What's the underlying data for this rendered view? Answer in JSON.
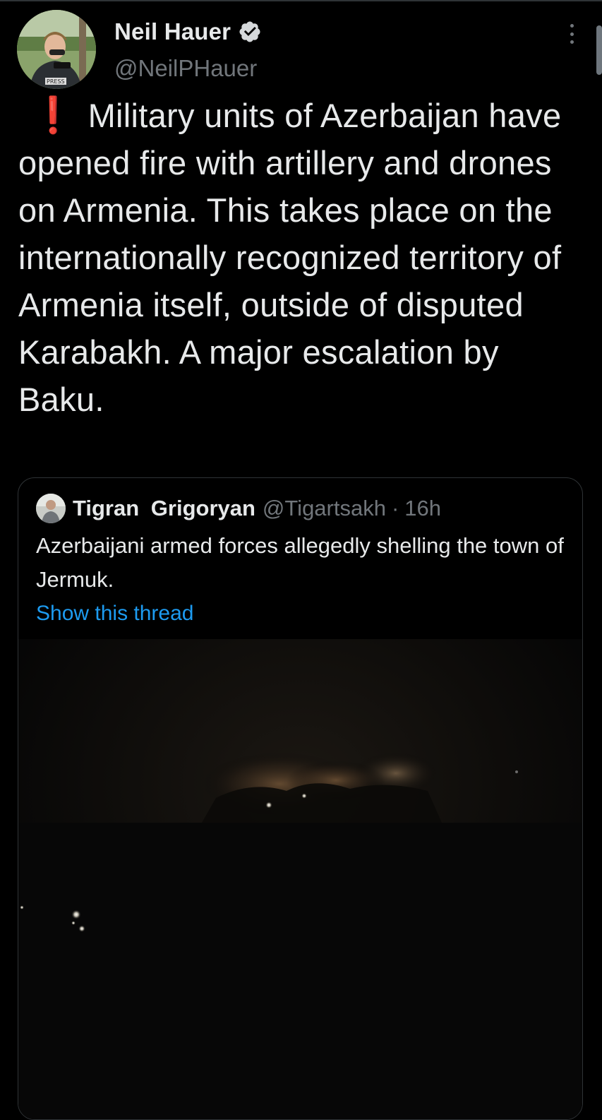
{
  "tweet": {
    "author": {
      "display_name": "Neil Hauer",
      "handle": "@NeilPHauer",
      "verified": true,
      "avatar_icon": "profile-photo"
    },
    "emphasis_icon": "❗",
    "text": "Military units of Azerbaijan have opened fire with artillery and drones on Armenia. This takes place on the internationally recognized territory of Armenia itself, outside of disputed Karabakh. A major escalation by Baku.",
    "more_icon": "more-vertical-icon"
  },
  "quoted_tweet": {
    "author": {
      "display_name": "Tigran  Grigoryan",
      "handle": "@Tigartsakh",
      "separator": "·",
      "time": "16h"
    },
    "text": "Azerbaijani armed forces allegedly shelling the town of Jermuk.",
    "show_thread_label": "Show this thread",
    "media_description_icon": "night-video-thumbnail"
  },
  "colors": {
    "background": "#000000",
    "text_primary": "#e7e9ea",
    "text_secondary": "#71767b",
    "link": "#1d9bf0",
    "border": "#2f3336",
    "alert": "#e3242b"
  }
}
